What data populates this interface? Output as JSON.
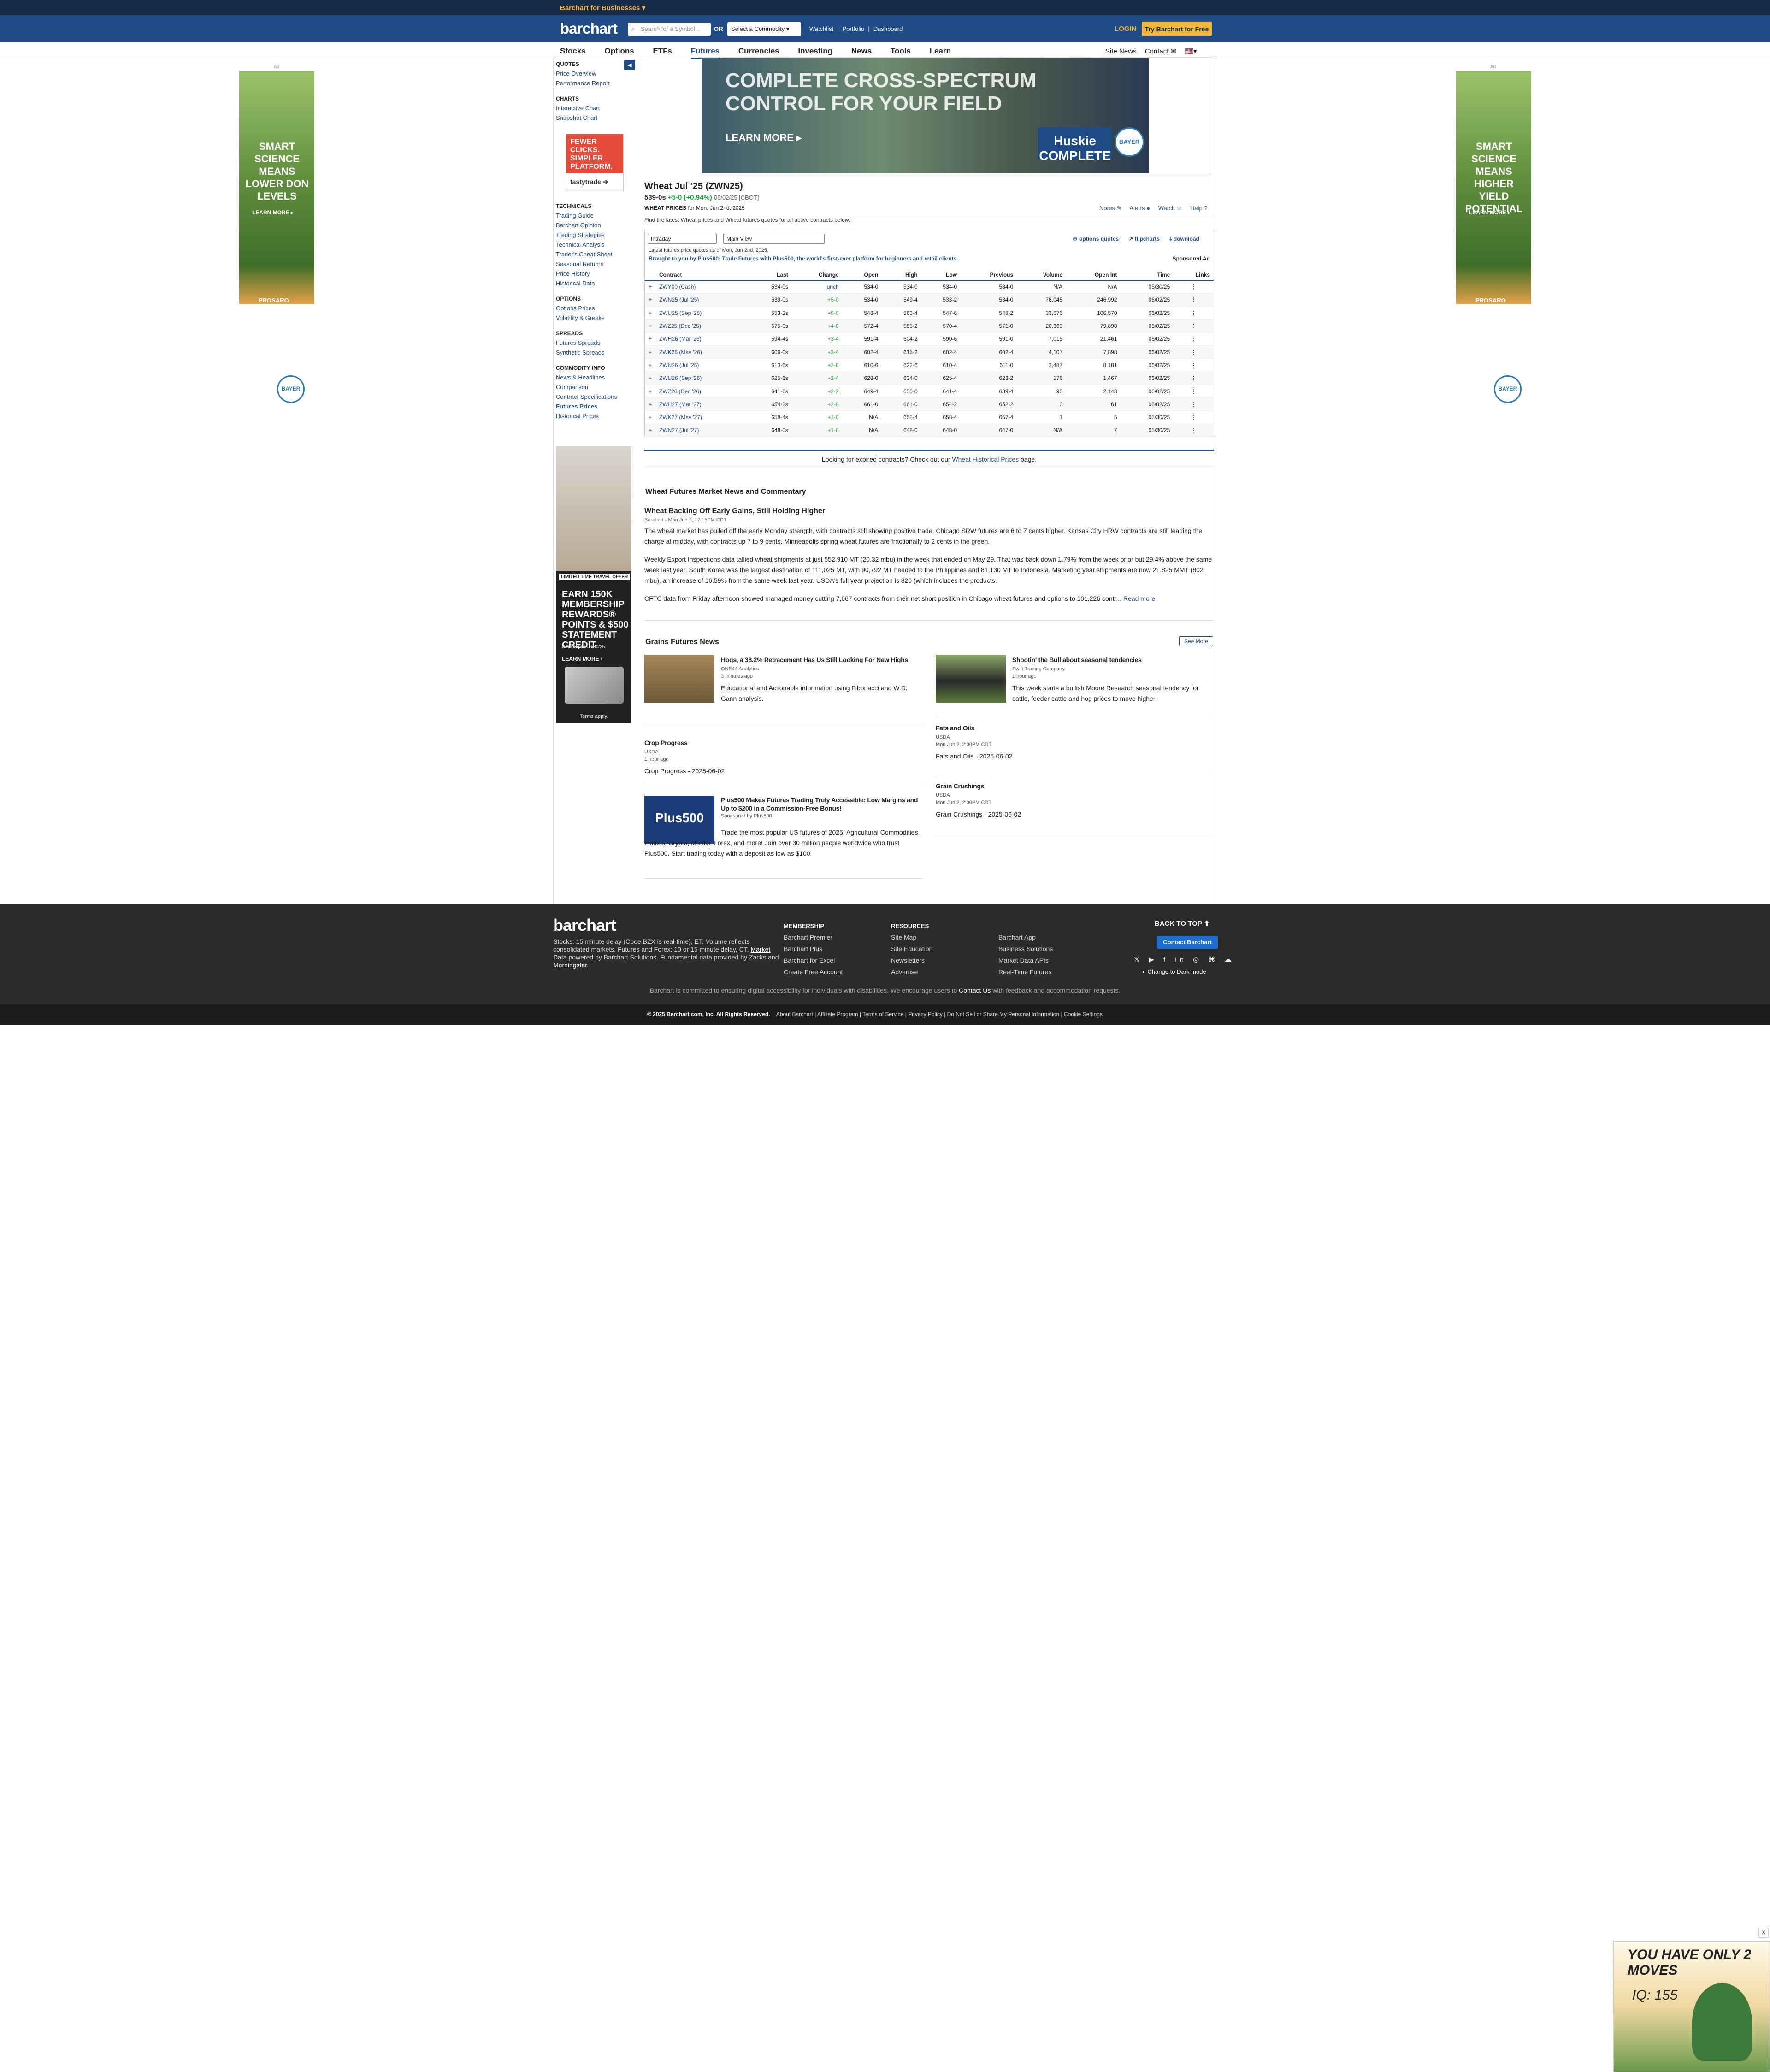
{
  "topbar": {
    "business": "Barchart for Businesses ▾"
  },
  "header": {
    "logo": "barchart",
    "search_placeholder": "Search for a Symbol...",
    "or": "OR",
    "commodity": "Select a Commodity ▾",
    "links": [
      "Watchlist",
      "|",
      "Portfolio",
      "|",
      "Dashboard"
    ],
    "login": "LOGIN",
    "try": "Try Barchart for Free"
  },
  "nav": {
    "tabs": [
      "Stocks",
      "Options",
      "ETFs",
      "Futures",
      "Currencies",
      "Investing",
      "News",
      "Tools",
      "Learn"
    ],
    "active": "Futures",
    "site_news": "Site News",
    "contact": "Contact ✉",
    "flag": "🇺🇸▾"
  },
  "ads": {
    "left_text": "SMART SCIENCE MEANS LOWER DON LEVELS",
    "right_text": "SMART SCIENCE MEANS HIGHER YIELD POTENTIAL",
    "learn_more": "LEARN MORE ▸",
    "prosaro": "PROSARO",
    "bayer": "BAYER",
    "ad_label": "Ad",
    "banner_headline": "COMPLETE CROSS-SPECTRUM CONTROL FOR YOUR FIELD",
    "banner_learn": "LEARN MORE ▸",
    "banner_brand": "Huskie COMPLETE",
    "tasty_headline": "FEWER CLICKS. SIMPLER PLATFORM.",
    "tasty_brand": "tastytrade ➔",
    "amex_limited": "LIMITED TIME TRAVEL OFFER",
    "amex_body": "EARN 150K MEMBERSHIP REWARDS® POINTS & $500 STATEMENT CREDIT",
    "amex_offer": "Offer expires 6/30/25.",
    "amex_learn": "LEARN MORE ›",
    "amex_terms": "Terms apply.",
    "game_head": "YOU HAVE ONLY 2 MOVES",
    "game_iq": "IQ: 155"
  },
  "sidebar": {
    "quotes_h": "QUOTES",
    "quotes": [
      "Price Overview",
      "Performance Report"
    ],
    "charts_h": "CHARTS",
    "charts": [
      "Interactive Chart",
      "Snapshot Chart"
    ],
    "tech_h": "TECHNICALS",
    "tech": [
      "Trading Guide",
      "Barchart Opinion",
      "Trading Strategies",
      "Technical Analysis",
      "Trader's Cheat Sheet",
      "Seasonal Returns",
      "Price History",
      "Historical Data"
    ],
    "options_h": "OPTIONS",
    "options": [
      "Options Prices",
      "Volatility & Greeks"
    ],
    "spreads_h": "SPREADS",
    "spreads": [
      "Futures Spreads",
      "Synthetic Spreads"
    ],
    "info_h": "COMMODITY INFO",
    "info": [
      "News & Headlines",
      "Comparison",
      "Contract Specifications",
      "Futures Prices",
      "Historical Prices"
    ]
  },
  "quote": {
    "title": "Wheat Jul '25 (ZWN25)",
    "last": "539-0s",
    "change": "+5-0 (+0.94%)",
    "date": "06/02/25 [CBOT]",
    "label": "WHEAT PRICES",
    "label_date": "for Mon, Jun 2nd, 2025",
    "desc": "Find the latest Wheat prices and Wheat futures quotes for all active contracts below.",
    "tools": [
      "Notes ✎",
      "Alerts ●",
      "Watch ☆",
      "Help ?"
    ]
  },
  "table": {
    "period": "Intraday",
    "view": "Main View",
    "opt_links": [
      "⚙ options quotes",
      "↗ flipcharts",
      "⤓ download"
    ],
    "asof": "Latest futures price quotes as of Mon, Jun 2nd, 2025.",
    "brought": "Brought to you by Plus500: Trade Futures with Plus500, the world's first-ever platform for beginners and retail clients",
    "sponsored": "Sponsored Ad",
    "headers": [
      "Contract",
      "Last",
      "Change",
      "Open",
      "High",
      "Low",
      "Previous",
      "Volume",
      "Open Int",
      "Time",
      "Links"
    ],
    "rows": [
      [
        "ZWY00 (Cash)",
        "534-0s",
        "unch",
        "534-0",
        "534-0",
        "534-0",
        "534-0",
        "N/A",
        "N/A",
        "05/30/25"
      ],
      [
        "ZWN25 (Jul '25)",
        "539-0s",
        "+5-0",
        "534-0",
        "549-4",
        "533-2",
        "534-0",
        "78,045",
        "246,992",
        "06/02/25"
      ],
      [
        "ZWU25 (Sep '25)",
        "553-2s",
        "+5-0",
        "548-4",
        "563-4",
        "547-6",
        "548-2",
        "33,676",
        "106,570",
        "06/02/25"
      ],
      [
        "ZWZ25 (Dec '25)",
        "575-0s",
        "+4-0",
        "572-4",
        "585-2",
        "570-4",
        "571-0",
        "20,360",
        "79,898",
        "06/02/25"
      ],
      [
        "ZWH26 (Mar '26)",
        "594-4s",
        "+3-4",
        "591-4",
        "604-2",
        "590-6",
        "591-0",
        "7,015",
        "21,461",
        "06/02/25"
      ],
      [
        "ZWK26 (May '26)",
        "606-0s",
        "+3-4",
        "602-4",
        "615-2",
        "602-4",
        "602-4",
        "4,107",
        "7,898",
        "06/02/25"
      ],
      [
        "ZWN26 (Jul '26)",
        "613-6s",
        "+2-6",
        "610-6",
        "622-6",
        "610-4",
        "611-0",
        "3,487",
        "8,181",
        "06/02/25"
      ],
      [
        "ZWU26 (Sep '26)",
        "625-6s",
        "+2-4",
        "628-0",
        "634-0",
        "625-4",
        "623-2",
        "176",
        "1,467",
        "06/02/25"
      ],
      [
        "ZWZ26 (Dec '26)",
        "641-6s",
        "+2-2",
        "649-4",
        "650-0",
        "641-4",
        "639-4",
        "95",
        "2,143",
        "06/02/25"
      ],
      [
        "ZWH27 (Mar '27)",
        "654-2s",
        "+2-0",
        "661-0",
        "661-0",
        "654-2",
        "652-2",
        "3",
        "61",
        "06/02/25"
      ],
      [
        "ZWK27 (May '27)",
        "658-4s",
        "+1-0",
        "N/A",
        "658-4",
        "658-4",
        "657-4",
        "1",
        "5",
        "05/30/25"
      ],
      [
        "ZWN27 (Jul '27)",
        "648-0s",
        "+1-0",
        "N/A",
        "648-0",
        "648-0",
        "647-0",
        "N/A",
        "7",
        "05/30/25"
      ]
    ]
  },
  "expired": {
    "pre": "Looking for expired contracts? Check out our",
    "link": "Wheat Historical Prices",
    "post": "page."
  },
  "news": {
    "heading": "Wheat Futures Market News and Commentary",
    "title": "Wheat Backing Off Early Gains, Still Holding Higher",
    "meta": "Barchart - Mon Jun 2, 12:15PM CDT",
    "p1": "The wheat market has pulled off the early Monday strength, with contracts still showing positive trade. Chicago SRW futures are 6 to 7 cents higher. Kansas City HRW contracts are still leading the charge at midday, with contracts up 7 to 9 cents. Minneapolis spring wheat futures are fractionally to 2 cents in the green.",
    "p2": "Weekly Export Inspections data tallied wheat shipments at just 552,910 MT (20.32 mbu) in the week that ended on May 29. That was back down 1.79% from the week prior but 29.4% above the same week last year. South Korea was the largest destination of 111,025 MT, with 90,792 MT headed to the Philippines and 81,130 MT to Indonesia. Marketing year shipments are now 21.825 MMT (802 mbu), an increase of 16.59% from the same week last year. USDA's full year projection is 820 (which includes the products.",
    "p3": "CFTC data from Friday afternoon showed managed money cutting 7,667 contracts from their net short position in Chicago wheat futures and options to 101,226 contr...",
    "read_more": "Read more"
  },
  "grains": {
    "heading": "Grains Futures News",
    "see_more": "See More",
    "a1": {
      "title": "Hogs, a 38.2% Retracement Has Us Still Looking For New Highs",
      "source": "ONE44 Analytics",
      "time": "3 minutes ago",
      "body": "Educational and Actionable information using Fibonacci and W.D. Gann analysis."
    },
    "a2": {
      "title": "Shootin' the Bull about seasonal tendencies",
      "source": "Swift Trading Company",
      "time": "1 hour ago",
      "body": "This week starts a bullish Moore Research seasonal tendency for cattle, feeder cattle and hog prices to move higher."
    },
    "a3": {
      "title": "Crop Progress",
      "source": "USDA",
      "time": "1 hour ago",
      "body": "Crop Progress - 2025-06-02"
    },
    "a4": {
      "title": "Fats and Oils",
      "source": "USDA",
      "time": "Mon Jun 2, 2:00PM CDT",
      "body": "Fats and Oils - 2025-06-02"
    },
    "a5": {
      "title": "Plus500 Makes Futures Trading Truly Accessible: Low Margins and Up to $200 in a Commission-Free Bonus!",
      "source": "Sponsored by Plus500",
      "body": "Trade the most popular US futures of 2025: Agricultural Commodities, Indices, Crypto, Metals, Forex, and more! Join over 30 million people worldwide who trust Plus500. Start trading today with a deposit as low as $100!",
      "logo": "Plus500"
    },
    "a6": {
      "title": "Grain Crushings",
      "source": "USDA",
      "time": "Mon Jun 2, 2:00PM CDT",
      "body": "Grain Crushings - 2025-06-02"
    }
  },
  "footer": {
    "logo": "barchart",
    "desc1": "Stocks: 15 minute delay (Cboe BZX is real-time), ET. Volume reflects consolidated markets. Futures and Forex: 10 or 15 minute delay, CT.",
    "md": "Market Data",
    "desc2": "powered by Barchart Solutions. Fundamental data provided by Zacks and",
    "ms": "Morningstar",
    "membership_h": "MEMBERSHIP",
    "membership": [
      "Barchart Premier",
      "Barchart Plus",
      "Barchart for Excel",
      "Create Free Account"
    ],
    "resources_h": "RESOURCES",
    "resources": [
      "Site Map",
      "Site Education",
      "Newsletters",
      "Advertise"
    ],
    "more": [
      "Barchart App",
      "Business Solutions",
      "Market Data APIs",
      "Real-Time Futures"
    ],
    "back_top": "BACK TO TOP ⬆",
    "contact": "Contact Barchart",
    "social": "𝕏 ▶ f in ◎ ⌘ ☁",
    "dark": "◐ Change to Dark mode",
    "access_pre": "Barchart is committed to ensuring digital accessibility for individuals with disabilities. We encourage users to",
    "access_link": "Contact Us",
    "access_post": "with feedback and accommodation requests.",
    "copyright": "© 2025 Barchart.com, Inc. All Rights Reserved.",
    "bottom_links": "About Barchart | Affiliate Program | Terms of Service | Privacy Policy | Do Not Sell or Share My Personal Information | Cookie Settings"
  }
}
